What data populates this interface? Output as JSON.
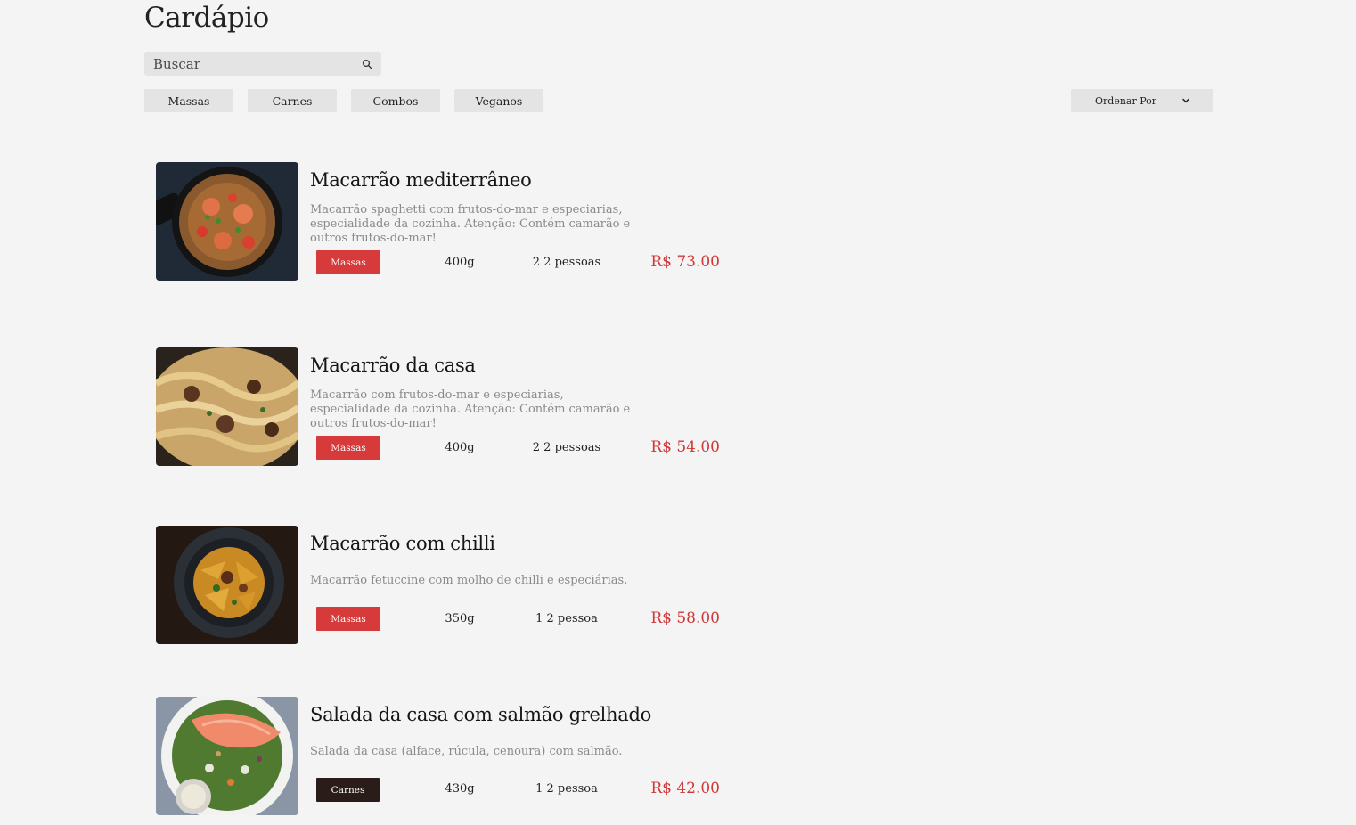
{
  "page": {
    "title": "Cardápio"
  },
  "search": {
    "placeholder": "Buscar"
  },
  "filters": [
    "Massas",
    "Carnes",
    "Combos",
    "Veganos"
  ],
  "sort": {
    "label": "Ordenar Por"
  },
  "colors": {
    "massas": "#d63a3a",
    "carnes": "#2a1c18",
    "price": "#d03838"
  },
  "menu": [
    {
      "name": "Macarrão mediterrâneo",
      "description": "Macarrão spaghetti com frutos-do-mar e especiarias, especialidade da cozinha. Atenção: Contém camarão e outros frutos-do-mar!",
      "category": "Massas",
      "weight": "400g",
      "serves": "2 2 pessoas",
      "price": "R$ 73.00"
    },
    {
      "name": "Macarrão da casa",
      "description": "Macarrão com frutos-do-mar e especiarias, especialidade da cozinha. Atenção: Contém camarão e outros frutos-do-mar!",
      "category": "Massas",
      "weight": "400g",
      "serves": "2 2 pessoas",
      "price": "R$ 54.00"
    },
    {
      "name": "Macarrão com chilli",
      "description": "Macarrão fetuccine com molho de chilli e especiárias.",
      "category": "Massas",
      "weight": "350g",
      "serves": "1 2 pessoa",
      "price": "R$ 58.00"
    },
    {
      "name": "Salada da casa com salmão grelhado",
      "description": "Salada da casa (alface, rúcula, cenoura) com salmão.",
      "category": "Carnes",
      "weight": "430g",
      "serves": "1 2 pessoa",
      "price": "R$ 42.00"
    }
  ]
}
